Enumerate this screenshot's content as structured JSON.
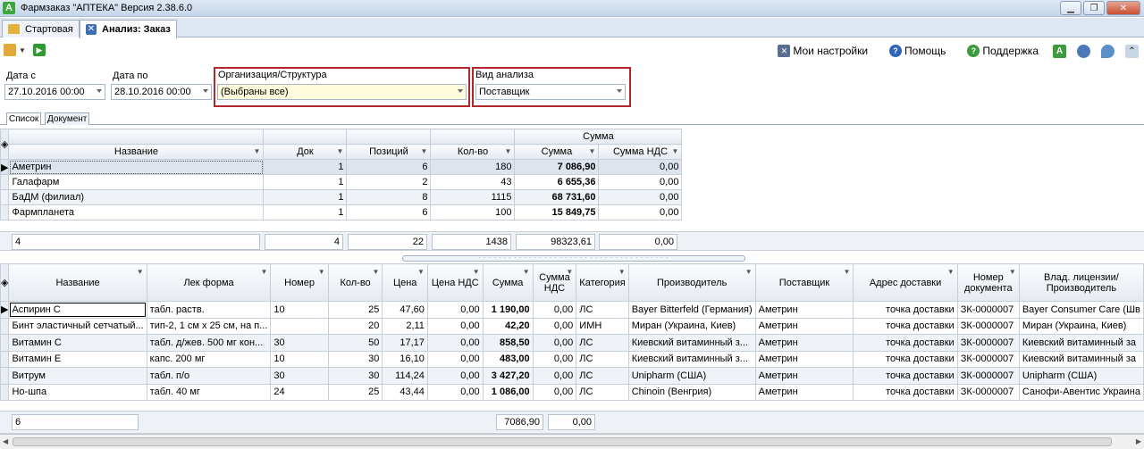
{
  "window": {
    "title": "Фармзаказ \"АПТЕКА\" Версия 2.38.6.0",
    "app_icon": "А"
  },
  "tabs": [
    {
      "label": "Стартовая",
      "icon": "home-icon"
    },
    {
      "label": "Анализ: Заказ",
      "icon": "close-icon",
      "close_glyph": "✕"
    }
  ],
  "toolbar": {
    "settings_label": "Мои настройки",
    "help_label": "Помощь",
    "support_label": "Поддержка",
    "help_glyph": "?",
    "support_glyph": "?",
    "a_glyph": "A"
  },
  "filters": {
    "date_from_label": "Дата с",
    "date_from_value": "27.10.2016 00:00",
    "date_to_label": "Дата по",
    "date_to_value": "28.10.2016 00:00",
    "org_label": "Организация/Структура",
    "org_value": "(Выбраны все)",
    "analysis_label": "Вид анализа",
    "analysis_value": "Поставщик"
  },
  "subtabs": [
    "Список",
    "Документ"
  ],
  "summary_grid": {
    "group_header": "Сумма",
    "columns": [
      "Название",
      "Док",
      "Позиций",
      "Кол-во",
      "Сумма",
      "Сумма НДС"
    ],
    "rows": [
      [
        "Аметрин",
        "1",
        "6",
        "180",
        "7 086,90",
        "0,00"
      ],
      [
        "Галафарм",
        "1",
        "2",
        "43",
        "6 655,36",
        "0,00"
      ],
      [
        "БаДМ (филиал)",
        "1",
        "8",
        "1115",
        "68 731,60",
        "0,00"
      ],
      [
        "Фармпланета",
        "1",
        "6",
        "100",
        "15 849,75",
        "0,00"
      ]
    ],
    "totals": [
      "4",
      "4",
      "22",
      "1438",
      "98323,61",
      "0,00"
    ]
  },
  "detail_grid": {
    "columns": [
      "Название",
      "Лек форма",
      "Номер",
      "Кол-во",
      "Цена",
      "Цена НДС",
      "Сумма",
      "Сумма НДС",
      "Категория",
      "Производитель",
      "Поставщик",
      "Адрес доставки",
      "Номер документа",
      "Влад. лицензии/Производитель"
    ],
    "rows": [
      [
        "Аспирин С",
        "табл. раств.",
        "10",
        "25",
        "47,60",
        "0,00",
        "1 190,00",
        "0,00",
        "ЛС",
        "Bayer Bitterfeld (Германия)",
        "Аметрин",
        "точка доставки",
        "ЗК-0000007",
        "Bayer Consumer Care (Шв"
      ],
      [
        "Бинт эластичный сетчатый...",
        "тип-2, 1 см x 25 см, на п...",
        "",
        "20",
        "2,11",
        "0,00",
        "42,20",
        "0,00",
        "ИМН",
        "Миран (Украина, Киев)",
        "Аметрин",
        "точка доставки",
        "ЗК-0000007",
        "Миран (Украина, Киев)"
      ],
      [
        "Витамин С",
        "табл. д/жев. 500 мг кон...",
        "30",
        "50",
        "17,17",
        "0,00",
        "858,50",
        "0,00",
        "ЛС",
        "Киевский витаминный з...",
        "Аметрин",
        "точка доставки",
        "ЗК-0000007",
        "Киевский витаминный за"
      ],
      [
        "Витамин Е",
        "капс. 200 мг",
        "10",
        "30",
        "16,10",
        "0,00",
        "483,00",
        "0,00",
        "ЛС",
        "Киевский витаминный з...",
        "Аметрин",
        "точка доставки",
        "ЗК-0000007",
        "Киевский витаминный за"
      ],
      [
        "Витрум",
        "табл. п/о",
        "30",
        "30",
        "114,24",
        "0,00",
        "3 427,20",
        "0,00",
        "ЛС",
        "Unipharm (США)",
        "Аметрин",
        "точка доставки",
        "ЗК-0000007",
        "Unipharm (США)"
      ],
      [
        "Но-шпа",
        "табл. 40 мг",
        "24",
        "25",
        "43,44",
        "0,00",
        "1 086,00",
        "0,00",
        "ЛС",
        "Chinoin (Венгрия)",
        "Аметрин",
        "точка доставки",
        "ЗК-0000007",
        "Санофи-Авентис Украина"
      ]
    ],
    "totals": [
      "6",
      "7086,90",
      "0,00"
    ]
  }
}
